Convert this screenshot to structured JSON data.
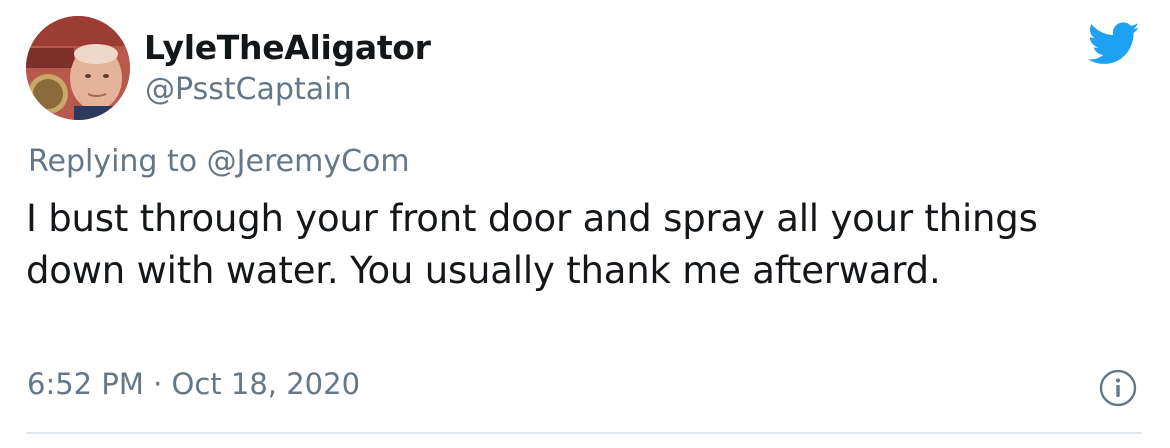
{
  "author": {
    "display_name": "LyleTheAligator",
    "handle": "@PsstCaptain",
    "avatar_icon": "profile-photo"
  },
  "reply": {
    "prefix": "Replying to ",
    "to_handle": "@JeremyCom"
  },
  "tweet": {
    "text": "I bust through your front door and spray all your things down with water. You usually thank me afterward."
  },
  "meta": {
    "time": "6:52 PM",
    "separator": " · ",
    "date": "Oct 18, 2020"
  },
  "icons": {
    "brand": "twitter-bird-icon",
    "info": "info-icon"
  },
  "colors": {
    "twitter_blue": "#1da1f2",
    "secondary_text": "#657786",
    "primary_text": "#14171a",
    "divider": "#e1e8ed"
  }
}
